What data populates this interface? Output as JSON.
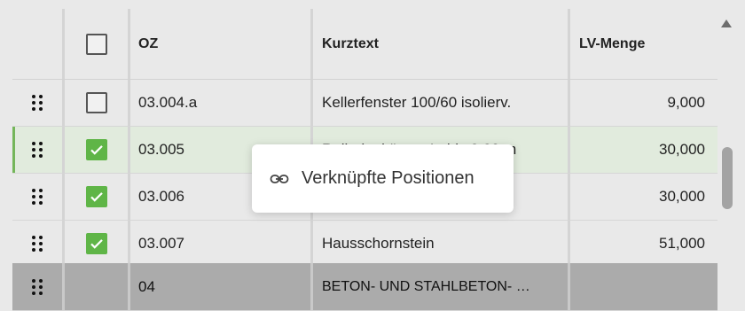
{
  "table": {
    "headers": {
      "oz": "OZ",
      "kurztext": "Kurztext",
      "lv_menge": "LV-Menge"
    },
    "rows": [
      {
        "oz": "03.004.a",
        "kurztext": "Kellerfenster 100/60 isolierv.",
        "lv_menge": "9,000",
        "checked": false
      },
      {
        "oz": "03.005",
        "kurztext": "Rolladenkästen L. bis 2,20 m",
        "lv_menge": "30,000",
        "checked": true
      },
      {
        "oz": "03.006",
        "kurztext": "",
        "lv_menge": "30,000",
        "checked": true
      },
      {
        "oz": "03.007",
        "kurztext": "Hausschornstein",
        "lv_menge": "51,000",
        "checked": true
      },
      {
        "oz": "04",
        "kurztext": "BETON- UND STAHLBETON- …",
        "lv_menge": ""
      }
    ]
  },
  "context_menu": {
    "item_label": "Verknüpfte Positionen",
    "icon": "link-icon"
  },
  "colors": {
    "check_green": "#5fb547",
    "selected_row": "#e1ebdd",
    "group_row": "#ababab"
  }
}
